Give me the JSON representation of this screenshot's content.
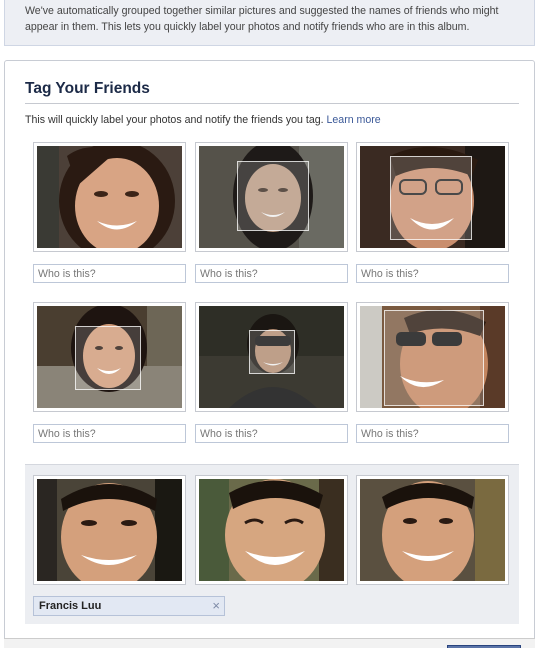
{
  "intro": {
    "line1": "We've automatically grouped together similar pictures and suggested the names of friends who might",
    "line2": "appear in them. This lets you quickly label your photos and notify friends who are in this album."
  },
  "panel": {
    "title": "Tag Your Friends",
    "subtitle": "This will quickly label your photos and notify the friends you tag.",
    "learn_more": "Learn more"
  },
  "faces": [
    {
      "placeholder": "Who is this?"
    },
    {
      "placeholder": "Who is this?"
    },
    {
      "placeholder": "Who is this?"
    },
    {
      "placeholder": "Who is this?"
    },
    {
      "placeholder": "Who is this?"
    },
    {
      "placeholder": "Who is this?"
    }
  ],
  "group": {
    "name": "Francis Luu",
    "remove_icon": "×"
  },
  "colors": {
    "link": "#3b5998",
    "title": "#1c2a47",
    "intro_bg": "#edeff4",
    "group_bg": "#eceef2"
  }
}
